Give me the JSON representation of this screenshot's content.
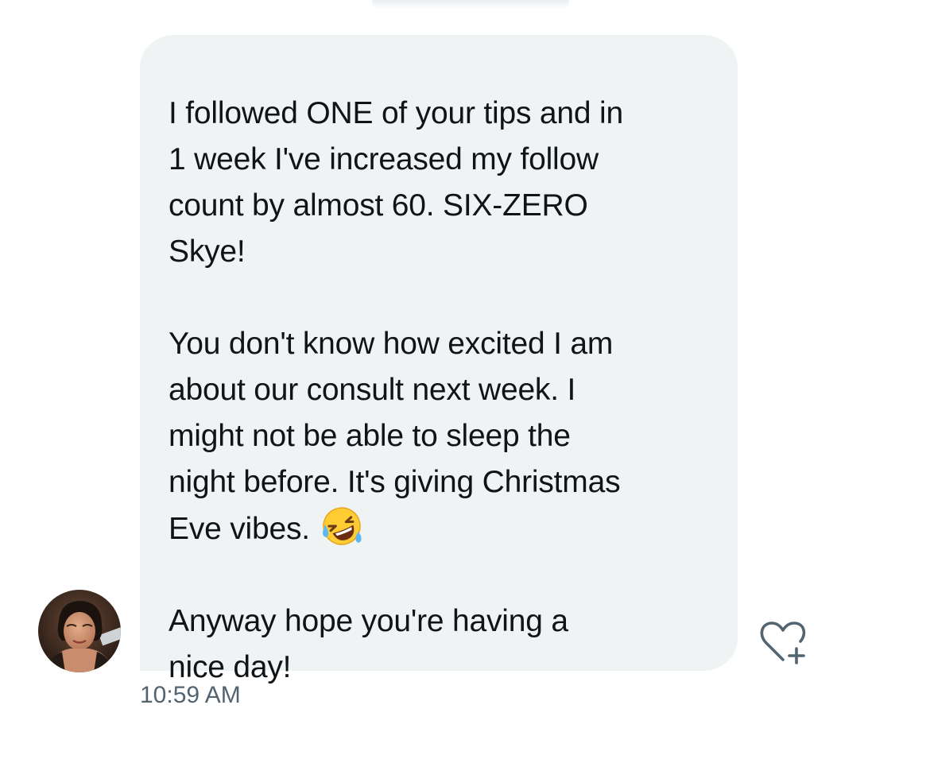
{
  "message": {
    "paragraphs": [
      {
        "lines": [
          "I followed ONE of your tips and in",
          "1 week I've increased my follow",
          "count by almost 60. SIX-ZERO",
          "Skye!"
        ]
      },
      {
        "lines": [
          "You don't know how excited I am",
          "about our consult next week. I",
          "might not be able to sleep the",
          "night before. It's giving Christmas",
          "Eve vibes."
        ],
        "trailing_emoji": "rolling-on-the-floor-laughing-emoji"
      },
      {
        "lines": [
          "Anyway hope you're having a",
          "nice day!"
        ]
      }
    ],
    "timestamp": "10:59 AM"
  },
  "icons": {
    "avatar": "sender-avatar",
    "react": "heart-plus-icon"
  },
  "colors": {
    "bubble_bg": "#eff3f4",
    "text": "#0f1419",
    "timestamp": "#536471",
    "icon_stroke": "#536471"
  }
}
